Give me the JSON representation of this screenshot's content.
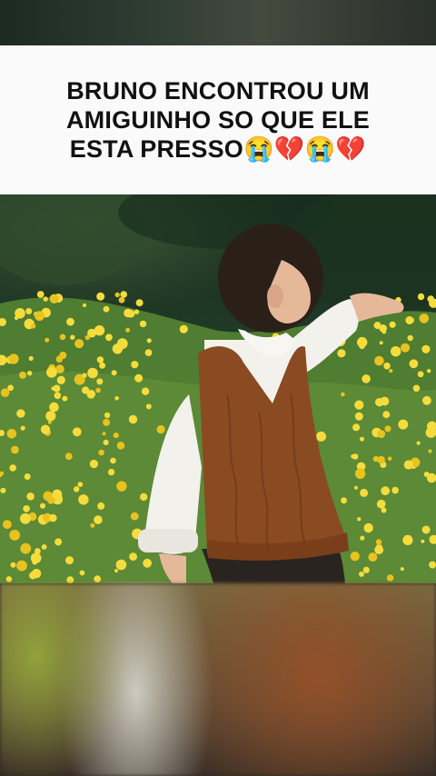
{
  "caption": {
    "lines": [
      "BRUNO ENCONTROU UM",
      "AMIGUINHO SO QUE ELE",
      "ESTA PRESSO😭💔😭💔"
    ]
  },
  "video": {
    "scene": "boy-in-flower-field"
  },
  "colors": {
    "caption_background": "#fafafa",
    "caption_text": "#111111",
    "flowers": "#f2d533",
    "vest": "#8a4a22"
  }
}
